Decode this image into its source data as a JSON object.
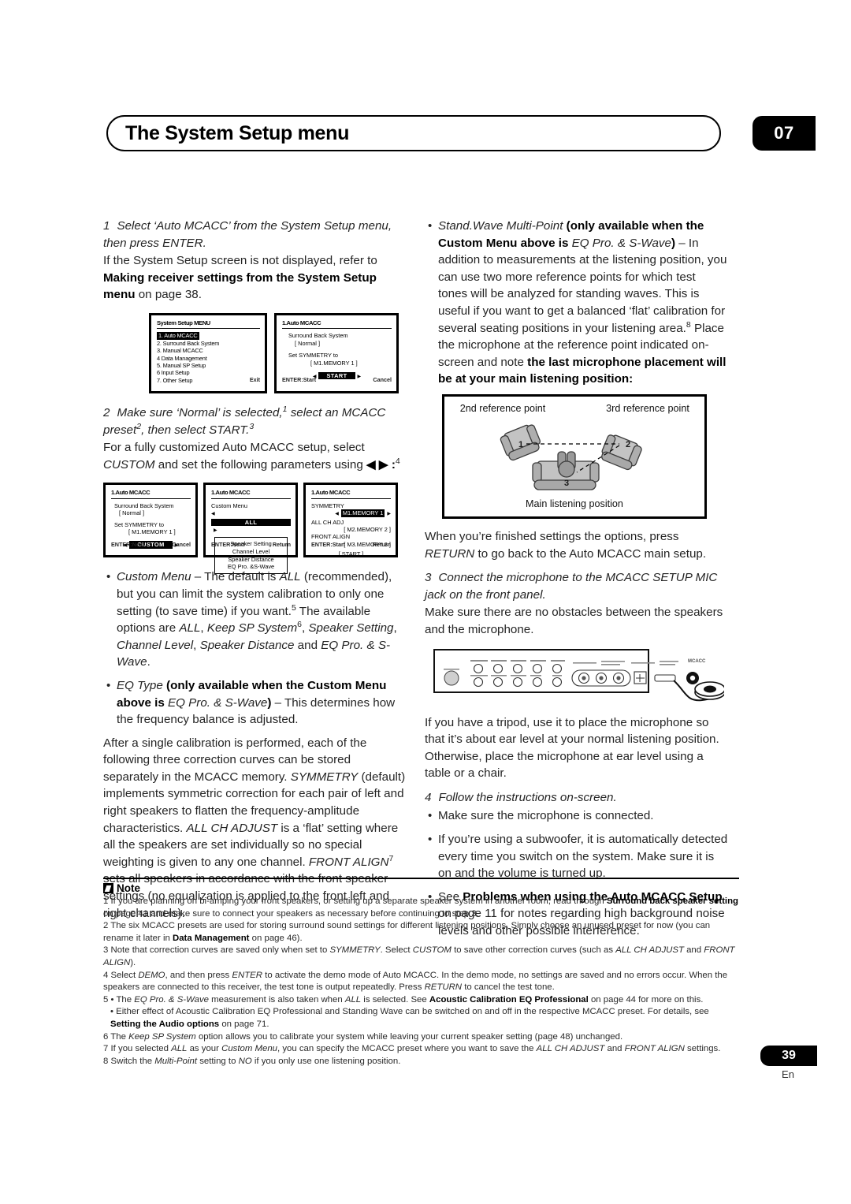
{
  "header": {
    "title": "The System Setup menu",
    "chapter": "07"
  },
  "left_column": {
    "step1": {
      "num": "1",
      "italic": "Select ‘Auto MCACC’ from the System Setup menu, then press ENTER.",
      "body_before": "If the System Setup screen is not displayed, refer to ",
      "body_bold": "Making receiver settings from the System Setup menu",
      "body_after": " on page 38."
    },
    "osd_row1": {
      "screen1": {
        "title": "System Setup MENU",
        "items": [
          "1. Auto MCACC",
          "2. Surround Back System",
          "3. Manual MCACC",
          "4 Data Management",
          "5. Manual SP Setup",
          "6 Input Setup",
          "7. Other Setup"
        ],
        "footer_right": "Exit"
      },
      "screen2": {
        "title": "1.Auto MCACC",
        "line1": "Surround Back System",
        "line2": "[     Normal     ]",
        "line3": "Set SYMMETRY to",
        "line4": "[ M1.MEMORY 1 ]",
        "button": "START",
        "footer_left": "ENTER:Start",
        "footer_right": "Cancel"
      }
    },
    "step2": {
      "num": "2",
      "italic": "Make sure ‘Normal’ is selected,",
      "italic_sup1": "1",
      "italic_mid": "select an MCACC preset",
      "italic_sup2": "2",
      "italic_end": ", then select START.",
      "italic_sup3": "3",
      "body_before": "For a fully customized Auto MCACC setup, select ",
      "body_italic": "CUSTOM",
      "body_after": " and set the following parameters using ",
      "body_keys": "◀ ▶ :",
      "body_sup": "4"
    },
    "osd_row2": {
      "screen1": {
        "title": "1.Auto MCACC",
        "line1": "Surround Back System",
        "line2": "[     Normal     ]",
        "line3": "Set SYMMETRY to",
        "line4": "[ M1.MEMORY 1 ]",
        "button": "CUSTOM",
        "footer_left": "ENTER:Next",
        "footer_right": "Cancel"
      },
      "screen2": {
        "title": "1.Auto MCACC",
        "subtitle": "Custom Menu",
        "selected": "ALL",
        "options": [
          "Speaker Setting",
          "Channel Level",
          "Speaker Distance",
          "EQ Pro. &S-Wave"
        ],
        "footer_left": "ENTER:Next",
        "footer_right": "Return"
      },
      "screen3": {
        "title": "1.Auto MCACC",
        "rows": [
          {
            "label": "SYMMETRY",
            "value": "M1.MEMORY 1",
            "highlight": true
          },
          {
            "label": "ALL CH ADJ",
            "value": "[ M2.MEMORY 2 ]",
            "highlight": false
          },
          {
            "label": "FRONT ALIGN",
            "value": "[ M3.MEMORY 3 ]",
            "highlight": false
          }
        ],
        "button": "[  START  ]",
        "footer_left": "ENTER:Start",
        "footer_right": "Return"
      }
    },
    "bullet_custom_menu": {
      "term": "Custom Menu",
      "text1": " – The default is ",
      "term2": "ALL",
      "text2": " (recommended), but you can limit the system calibration to only one setting (to save time) if you want.",
      "sup": "5",
      "text3": " The available options are ",
      "opt1": "ALL",
      "opt2": "Keep SP System",
      "sup2": "6",
      "opt3": "Speaker Setting",
      "opt4": "Channel Level",
      "opt5": "Speaker Distance",
      "text4": " and ",
      "opt6": "EQ Pro. & S-Wave",
      "text5": "."
    },
    "bullet_eq_type": {
      "term": "EQ Type",
      "bold1": "(only available when the Custom Menu above is ",
      "italic1": "EQ Pro. & S-Wave",
      "bold2": ")",
      "text": " – This determines how the frequency balance is adjusted."
    },
    "final_para": {
      "t1": "After a single calibration is performed, each of the following three correction curves can be stored separately in the MCACC memory. ",
      "i1": "SYMMETRY",
      "t2": " (default) implements symmetric correction for each pair of left and right speakers to flatten the frequency-amplitude characteristics. ",
      "i2": "ALL CH ADJUST",
      "t3": " is a ‘flat’ setting where all the speakers are set individually so no special weighting is given to any one channel. ",
      "i3": "FRONT ALIGN",
      "sup": "7",
      "t4": " sets all speakers in accordance with the front speaker settings (no equalization is applied to the front left and right channels)."
    }
  },
  "right_column": {
    "bullet_standwave": {
      "term": "Stand.Wave Multi-Point",
      "bold1": "(only available when the Custom Menu above is ",
      "italic1": "EQ Pro. & S-Wave",
      "bold2": ")",
      "text1": " – In addition to measurements at the listening position, you can use two more reference points for which test tones will be analyzed for standing waves. This is useful if you want to get a balanced ‘flat’ calibration for several seating positions in your listening area.",
      "sup": "8",
      "text2": " Place the microphone at the reference point indicated on-screen and note ",
      "bold3": "the last microphone placement will be at your main listening position:"
    },
    "room_diagram": {
      "label_2nd": "2nd reference point",
      "label_3rd": "3rd reference point",
      "label_main": "Main listening position",
      "seat1": "1",
      "seat2": "2",
      "seat3": "3"
    },
    "after_diagram": {
      "t1": "When you’re finished settings the options, press ",
      "i1": "RETURN",
      "t2": " to go back to the Auto MCACC main setup."
    },
    "step3": {
      "num": "3",
      "italic": "Connect the microphone to the MCACC SETUP MIC jack on the front panel.",
      "body": "Make sure there are no obstacles between the speakers and the microphone."
    },
    "after_receiver": "If you have a tripod, use it to place the microphone so that it’s about ear level at your normal listening position. Otherwise, place the microphone at ear level using a table or a chair.",
    "step4": {
      "num": "4",
      "italic": "Follow the instructions on-screen.",
      "bullets": [
        {
          "text": "Make sure the microphone is connected."
        },
        {
          "text": "If you’re using a subwoofer, it is automatically detected every time you switch on the system. Make sure it is on and the volume is turned up."
        }
      ],
      "bullet3_pre": "See ",
      "bullet3_bold": "Problems when using the Auto MCACC Setup",
      "bullet3_post": " on page 11 for notes regarding high background noise levels and other possible interference."
    }
  },
  "notes": {
    "heading": "Note",
    "items": [
      {
        "pre": "1 If you are planning on bi-amping your front speakers, or setting up a separate speaker system in another room, read through ",
        "bold": "Surround back speaker setting",
        "post": " on page 41 and make sure to connect your speakers as necessary before continuing to step 3."
      },
      {
        "pre": "2 The six MCACC presets are used for storing surround sound settings for different listening positions. Simply choose an unused preset for now (you can rename it later in ",
        "bold": "Data Management",
        "post": " on page 46)."
      },
      {
        "pre": "3 Note that correction curves are saved only when set to ",
        "italic1": "SYMMETRY",
        "mid1": ". Select ",
        "italic2": "CUSTOM",
        "mid2": " to save other correction curves (such as ",
        "italic3": "ALL CH ADJUST",
        "mid3": " and ",
        "italic4": "FRONT ALIGN",
        "post": ")."
      },
      {
        "pre": "4 Select ",
        "italic1": "DEMO",
        "mid1": ", and then press ",
        "italic2": "ENTER",
        "mid2": " to activate the demo mode of Auto MCACC. In the demo mode, no settings are saved and no errors occur. When the speakers are connected to this receiver, the test tone is output repeatedly. Press ",
        "italic3": "RETURN",
        "post": " to cancel the test tone."
      },
      {
        "pre": "5 • The ",
        "italic1": "EQ Pro. & S-Wave",
        "mid1": " measurement is also taken when ",
        "italic2": "ALL",
        "mid2": " is selected. See ",
        "bold": "Acoustic Calibration EQ Professional",
        "post": " on page 44 for more on this."
      },
      {
        "pre": "• Either effect of Acoustic Calibration EQ Professional and Standing Wave can be switched on and off in the respective MCACC preset. For details, see ",
        "bold": "Setting the Audio options",
        "post": " on page 71."
      },
      {
        "pre": "6 The ",
        "italic1": "Keep SP System",
        "post": " option allows you to calibrate your system while leaving your current speaker setting (page 48) unchanged."
      },
      {
        "pre": "7 If you selected ",
        "italic1": "ALL",
        "mid1": " as your ",
        "italic2": "Custom Menu",
        "mid2": ", you can specify the MCACC preset where you want to save the ",
        "italic3": "ALL CH ADJUST",
        "mid3": " and ",
        "italic4": "FRONT ALIGN",
        "post": " settings."
      },
      {
        "pre": "8 Switch the ",
        "italic1": "Multi-Point",
        "mid1": " setting to ",
        "italic2": "NO",
        "post": " if you only use one listening position."
      }
    ]
  },
  "footer": {
    "page": "39",
    "lang": "En"
  }
}
